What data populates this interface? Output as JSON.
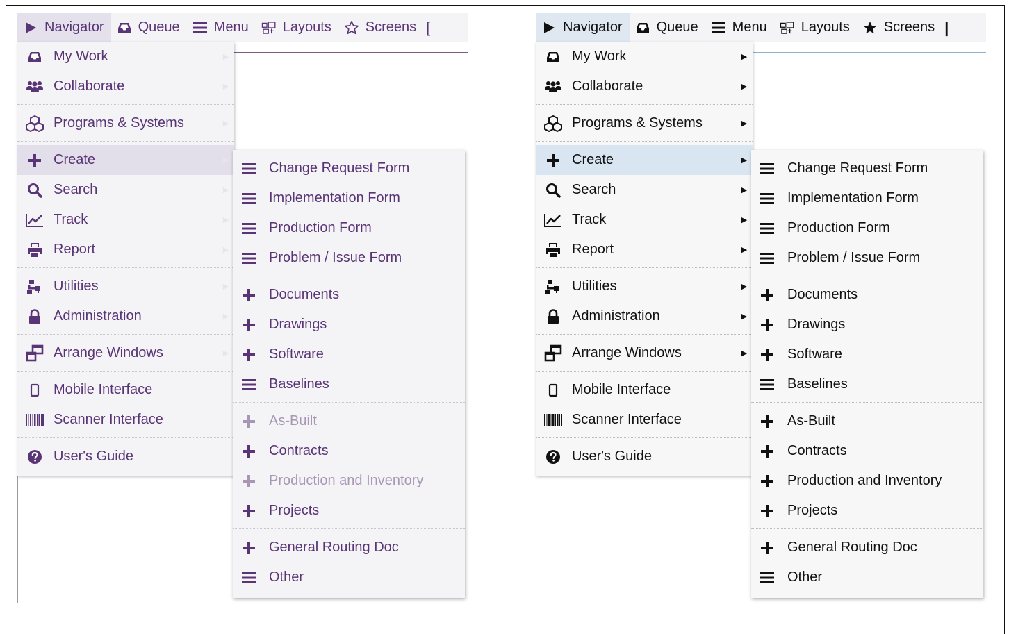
{
  "panels": [
    {
      "id": "left",
      "theme": "purple",
      "topbar": [
        {
          "label": "Navigator",
          "icon": "play-icon"
        },
        {
          "label": "Queue",
          "icon": "inbox-icon"
        },
        {
          "label": "Menu",
          "icon": "hamburger-icon"
        },
        {
          "label": "Layouts",
          "icon": "layout-icon"
        },
        {
          "label": "Screens",
          "icon": "star-outline-icon"
        }
      ],
      "topbar_edge": "[",
      "menu": [
        {
          "label": "My Work",
          "icon": "inbox-icon"
        },
        {
          "label": "Collaborate",
          "icon": "users-icon"
        },
        {
          "label": "Programs & Systems",
          "icon": "cubes-icon"
        },
        {
          "label": "Create",
          "icon": "plus-icon"
        },
        {
          "label": "Search",
          "icon": "search-icon"
        },
        {
          "label": "Track",
          "icon": "line-chart-icon"
        },
        {
          "label": "Report",
          "icon": "print-icon"
        },
        {
          "label": "Utilities",
          "icon": "sitemap-icon"
        },
        {
          "label": "Administration",
          "icon": "lock-icon"
        },
        {
          "label": "Arrange Windows",
          "icon": "windows-icon"
        },
        {
          "label": "Mobile Interface",
          "icon": "mobile-icon"
        },
        {
          "label": "Scanner Interface",
          "icon": "barcode-icon"
        },
        {
          "label": "User's Guide",
          "icon": "question-icon"
        }
      ],
      "submenu": [
        {
          "label": "Change Request Form",
          "icon": "hamburger-icon"
        },
        {
          "label": "Implementation Form",
          "icon": "hamburger-icon"
        },
        {
          "label": "Production Form",
          "icon": "hamburger-icon"
        },
        {
          "label": "Problem / Issue Form",
          "icon": "hamburger-icon"
        },
        {
          "label": "Documents",
          "icon": "plus-icon"
        },
        {
          "label": "Drawings",
          "icon": "plus-icon"
        },
        {
          "label": "Software",
          "icon": "plus-icon"
        },
        {
          "label": "Baselines",
          "icon": "hamburger-icon"
        },
        {
          "label": "As-Built",
          "icon": "plus-icon"
        },
        {
          "label": "Contracts",
          "icon": "plus-icon"
        },
        {
          "label": "Production and Inventory",
          "icon": "plus-icon"
        },
        {
          "label": "Projects",
          "icon": "plus-icon"
        },
        {
          "label": "General Routing Doc",
          "icon": "plus-icon"
        },
        {
          "label": "Other",
          "icon": "hamburger-icon"
        }
      ]
    },
    {
      "id": "right",
      "theme": "dark",
      "topbar": [
        {
          "label": "Navigator",
          "icon": "play-icon"
        },
        {
          "label": "Queue",
          "icon": "inbox-icon"
        },
        {
          "label": "Menu",
          "icon": "hamburger-icon"
        },
        {
          "label": "Layouts",
          "icon": "layout-icon"
        },
        {
          "label": "Screens",
          "icon": "star-icon"
        }
      ],
      "topbar_edge": "|",
      "menu": [
        {
          "label": "My Work",
          "icon": "inbox-icon"
        },
        {
          "label": "Collaborate",
          "icon": "users-icon"
        },
        {
          "label": "Programs & Systems",
          "icon": "cubes-icon"
        },
        {
          "label": "Create",
          "icon": "plus-icon"
        },
        {
          "label": "Search",
          "icon": "search-icon"
        },
        {
          "label": "Track",
          "icon": "line-chart-icon"
        },
        {
          "label": "Report",
          "icon": "print-icon"
        },
        {
          "label": "Utilities",
          "icon": "sitemap-icon"
        },
        {
          "label": "Administration",
          "icon": "lock-icon"
        },
        {
          "label": "Arrange Windows",
          "icon": "windows-icon"
        },
        {
          "label": "Mobile Interface",
          "icon": "mobile-icon"
        },
        {
          "label": "Scanner Interface",
          "icon": "barcode-icon"
        },
        {
          "label": "User's Guide",
          "icon": "question-icon"
        }
      ],
      "submenu": [
        {
          "label": "Change Request Form",
          "icon": "hamburger-icon"
        },
        {
          "label": "Implementation Form",
          "icon": "hamburger-icon"
        },
        {
          "label": "Production Form",
          "icon": "hamburger-icon"
        },
        {
          "label": "Problem / Issue Form",
          "icon": "hamburger-icon"
        },
        {
          "label": "Documents",
          "icon": "plus-icon"
        },
        {
          "label": "Drawings",
          "icon": "plus-icon"
        },
        {
          "label": "Software",
          "icon": "plus-icon"
        },
        {
          "label": "Baselines",
          "icon": "hamburger-icon"
        },
        {
          "label": "As-Built",
          "icon": "plus-icon"
        },
        {
          "label": "Contracts",
          "icon": "plus-icon"
        },
        {
          "label": "Production and Inventory",
          "icon": "plus-icon"
        },
        {
          "label": "Projects",
          "icon": "plus-icon"
        },
        {
          "label": "General Routing Doc",
          "icon": "plus-icon"
        },
        {
          "label": "Other",
          "icon": "hamburger-icon"
        }
      ]
    }
  ],
  "colors": {
    "purple_text": "#5a3576",
    "purple_disabled": "#a797b5",
    "purple_active_bg": "#e3dfea",
    "dark_text": "#111111",
    "blue_active_bg": "#d9e6f2"
  }
}
